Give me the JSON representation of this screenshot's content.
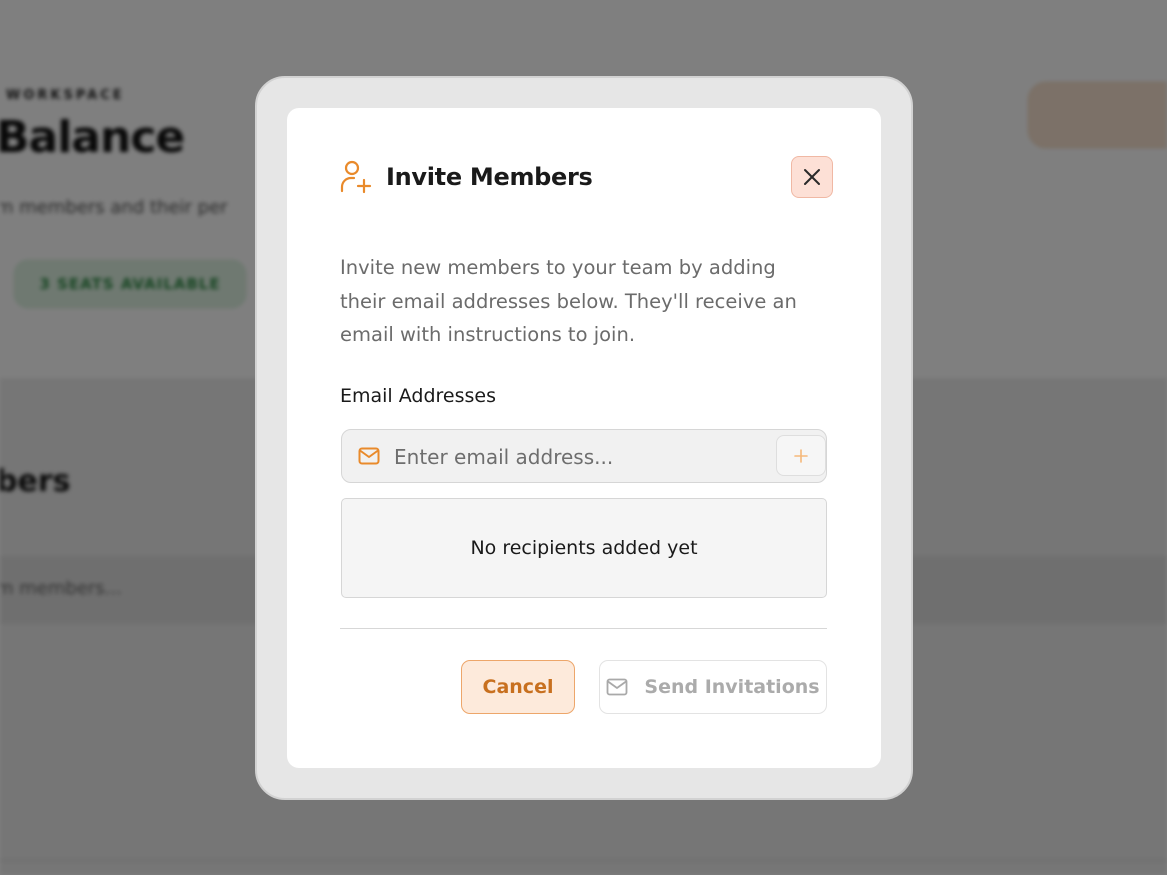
{
  "background": {
    "eyebrow": "WORKSPACE",
    "title": "Balance",
    "subtitle": "m members and their per",
    "seats_badge": "3 SEATS AVAILABLE",
    "section_title": "bers",
    "search_placeholder": "m members..."
  },
  "modal": {
    "title": "Invite Members",
    "title_icon": "user-plus-icon",
    "close_icon": "close-icon",
    "description": "Invite new members to your team by adding their email addresses below. They'll receive an email with instructions to join.",
    "email_label": "Email Addresses",
    "email_input": {
      "placeholder": "Enter email address...",
      "value": "",
      "icon": "mail-icon"
    },
    "add_icon": "plus-icon",
    "recipients_empty_text": "No recipients added yet",
    "cancel_label": "Cancel",
    "send_label": "Send Invitations",
    "send_icon": "mail-icon"
  },
  "colors": {
    "accent": "#e98a2b",
    "accent_soft": "#fdeadb",
    "close_bg": "#fde0d6",
    "overlay": "rgba(0,0,0,0.5)",
    "badge_green": "#2f8b45"
  }
}
